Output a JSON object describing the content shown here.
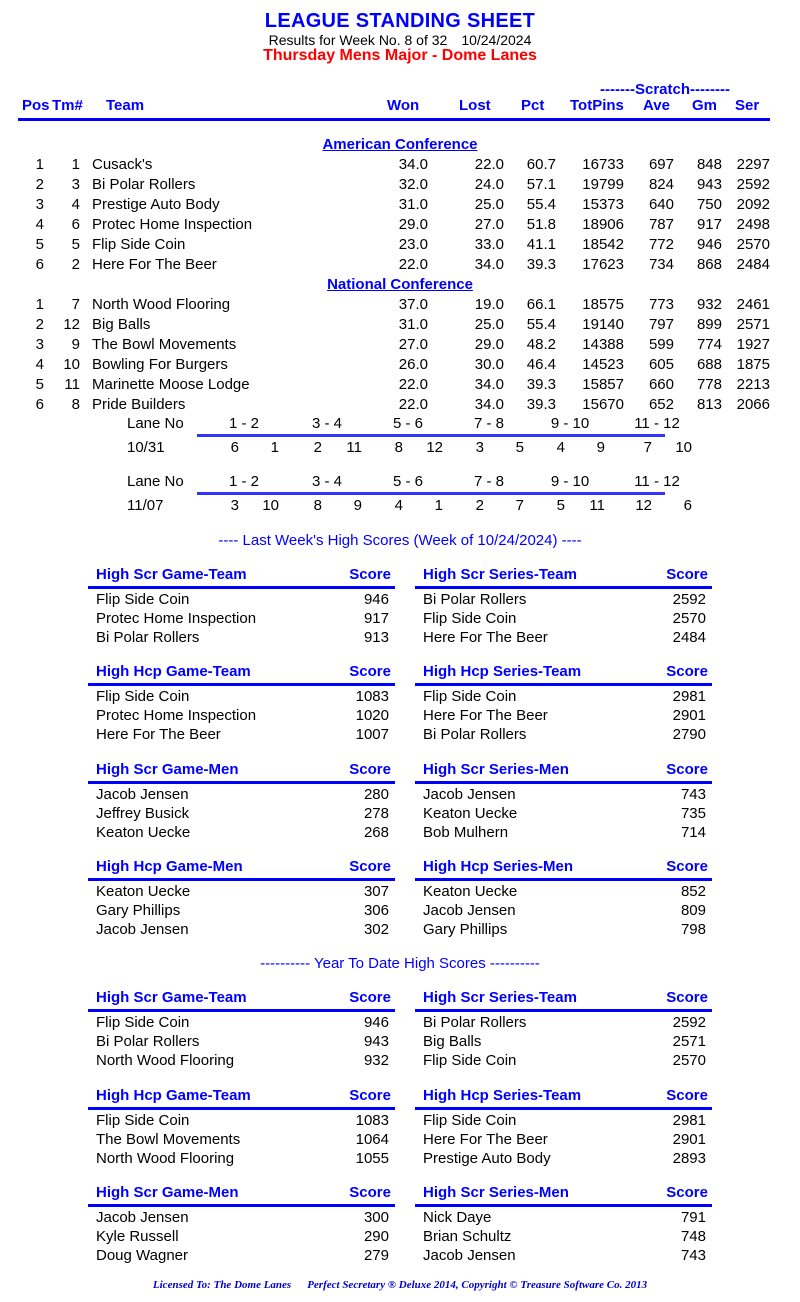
{
  "header": {
    "title": "LEAGUE STANDING SHEET",
    "results_line_left": "Results for Week No. 8 of 32",
    "results_line_date": "10/24/2024",
    "league_line": "Thursday Mens Major - Dome Lanes",
    "title_color": "#0000ff",
    "league_color": "#ff0000"
  },
  "standings": {
    "scratch_label": "-------Scratch--------",
    "columns": {
      "pos": "Pos",
      "tm": "Tm#",
      "team": "Team",
      "won": "Won",
      "lost": "Lost",
      "pct": "Pct",
      "totpins": "TotPins",
      "ave": "Ave",
      "gm": "Gm",
      "ser": "Ser"
    },
    "conferences": [
      {
        "name": "American Conference",
        "rows": [
          {
            "pos": "1",
            "tm": "1",
            "team": "Cusack's",
            "won": "34.0",
            "lost": "22.0",
            "pct": "60.7",
            "totpins": "16733",
            "ave": "697",
            "gm": "848",
            "ser": "2297"
          },
          {
            "pos": "2",
            "tm": "3",
            "team": "Bi Polar Rollers",
            "won": "32.0",
            "lost": "24.0",
            "pct": "57.1",
            "totpins": "19799",
            "ave": "824",
            "gm": "943",
            "ser": "2592"
          },
          {
            "pos": "3",
            "tm": "4",
            "team": "Prestige Auto Body",
            "won": "31.0",
            "lost": "25.0",
            "pct": "55.4",
            "totpins": "15373",
            "ave": "640",
            "gm": "750",
            "ser": "2092"
          },
          {
            "pos": "4",
            "tm": "6",
            "team": "Protec Home Inspection",
            "won": "29.0",
            "lost": "27.0",
            "pct": "51.8",
            "totpins": "18906",
            "ave": "787",
            "gm": "917",
            "ser": "2498"
          },
          {
            "pos": "5",
            "tm": "5",
            "team": "Flip Side Coin",
            "won": "23.0",
            "lost": "33.0",
            "pct": "41.1",
            "totpins": "18542",
            "ave": "772",
            "gm": "946",
            "ser": "2570"
          },
          {
            "pos": "6",
            "tm": "2",
            "team": "Here For The Beer",
            "won": "22.0",
            "lost": "34.0",
            "pct": "39.3",
            "totpins": "17623",
            "ave": "734",
            "gm": "868",
            "ser": "2484"
          }
        ]
      },
      {
        "name": "National Conference",
        "rows": [
          {
            "pos": "1",
            "tm": "7",
            "team": "North Wood Flooring",
            "won": "37.0",
            "lost": "19.0",
            "pct": "66.1",
            "totpins": "18575",
            "ave": "773",
            "gm": "932",
            "ser": "2461"
          },
          {
            "pos": "2",
            "tm": "12",
            "team": "Big Balls",
            "won": "31.0",
            "lost": "25.0",
            "pct": "55.4",
            "totpins": "19140",
            "ave": "797",
            "gm": "899",
            "ser": "2571"
          },
          {
            "pos": "3",
            "tm": "9",
            "team": "The Bowl Movements",
            "won": "27.0",
            "lost": "29.0",
            "pct": "48.2",
            "totpins": "14388",
            "ave": "599",
            "gm": "774",
            "ser": "1927"
          },
          {
            "pos": "4",
            "tm": "10",
            "team": "Bowling For Burgers",
            "won": "26.0",
            "lost": "30.0",
            "pct": "46.4",
            "totpins": "14523",
            "ave": "605",
            "gm": "688",
            "ser": "1875"
          },
          {
            "pos": "5",
            "tm": "11",
            "team": "Marinette Moose Lodge",
            "won": "22.0",
            "lost": "34.0",
            "pct": "39.3",
            "totpins": "15857",
            "ave": "660",
            "gm": "778",
            "ser": "2213"
          },
          {
            "pos": "6",
            "tm": "8",
            "team": "Pride Builders",
            "won": "22.0",
            "lost": "34.0",
            "pct": "39.3",
            "totpins": "15670",
            "ave": "652",
            "gm": "813",
            "ser": "2066"
          }
        ]
      }
    ]
  },
  "lane_schedule": {
    "lane_label": "Lane No",
    "lane_pairs": [
      "1 - 2",
      "3 - 4",
      "5 - 6",
      "7 - 8",
      "9 - 10",
      "11 - 12"
    ],
    "weeks": [
      {
        "date": "10/31",
        "matchups": [
          [
            "6",
            "1"
          ],
          [
            "2",
            "11"
          ],
          [
            "8",
            "12"
          ],
          [
            "3",
            "5"
          ],
          [
            "4",
            "9"
          ],
          [
            "7",
            "10"
          ]
        ]
      },
      {
        "date": "11/07",
        "matchups": [
          [
            "3",
            "10"
          ],
          [
            "8",
            "9"
          ],
          [
            "4",
            "1"
          ],
          [
            "2",
            "7"
          ],
          [
            "5",
            "11"
          ],
          [
            "12",
            "6"
          ]
        ]
      }
    ]
  },
  "last_week": {
    "banner": "----  Last Week's High Scores   (Week of 10/24/2024)  ----",
    "score_header": "Score",
    "groups": [
      {
        "left": {
          "title": "High Scr Game-Team",
          "rows": [
            {
              "name": "Flip Side Coin",
              "score": "946"
            },
            {
              "name": "Protec Home Inspection",
              "score": "917"
            },
            {
              "name": "Bi Polar Rollers",
              "score": "913"
            }
          ]
        },
        "right": {
          "title": "High Scr Series-Team",
          "rows": [
            {
              "name": "Bi Polar Rollers",
              "score": "2592"
            },
            {
              "name": "Flip Side Coin",
              "score": "2570"
            },
            {
              "name": "Here For The Beer",
              "score": "2484"
            }
          ]
        }
      },
      {
        "left": {
          "title": "High Hcp Game-Team",
          "rows": [
            {
              "name": "Flip Side Coin",
              "score": "1083"
            },
            {
              "name": "Protec Home Inspection",
              "score": "1020"
            },
            {
              "name": "Here For The Beer",
              "score": "1007"
            }
          ]
        },
        "right": {
          "title": "High Hcp Series-Team",
          "rows": [
            {
              "name": "Flip Side Coin",
              "score": "2981"
            },
            {
              "name": "Here For The Beer",
              "score": "2901"
            },
            {
              "name": "Bi Polar Rollers",
              "score": "2790"
            }
          ]
        }
      },
      {
        "left": {
          "title": "High Scr Game-Men",
          "rows": [
            {
              "name": "Jacob Jensen",
              "score": "280"
            },
            {
              "name": "Jeffrey Busick",
              "score": "278"
            },
            {
              "name": "Keaton Uecke",
              "score": "268"
            }
          ]
        },
        "right": {
          "title": "High Scr Series-Men",
          "rows": [
            {
              "name": "Jacob Jensen",
              "score": "743"
            },
            {
              "name": "Keaton Uecke",
              "score": "735"
            },
            {
              "name": "Bob Mulhern",
              "score": "714"
            }
          ]
        }
      },
      {
        "left": {
          "title": "High Hcp Game-Men",
          "rows": [
            {
              "name": "Keaton Uecke",
              "score": "307"
            },
            {
              "name": "Gary Phillips",
              "score": "306"
            },
            {
              "name": "Jacob Jensen",
              "score": "302"
            }
          ]
        },
        "right": {
          "title": "High Hcp Series-Men",
          "rows": [
            {
              "name": "Keaton Uecke",
              "score": "852"
            },
            {
              "name": "Jacob Jensen",
              "score": "809"
            },
            {
              "name": "Gary Phillips",
              "score": "798"
            }
          ]
        }
      }
    ]
  },
  "year_to_date": {
    "banner": "---------- Year To Date High Scores ----------",
    "score_header": "Score",
    "groups": [
      {
        "left": {
          "title": "High Scr Game-Team",
          "rows": [
            {
              "name": "Flip Side Coin",
              "score": "946"
            },
            {
              "name": "Bi Polar Rollers",
              "score": "943"
            },
            {
              "name": "North Wood Flooring",
              "score": "932"
            }
          ]
        },
        "right": {
          "title": "High Scr Series-Team",
          "rows": [
            {
              "name": "Bi Polar Rollers",
              "score": "2592"
            },
            {
              "name": "Big Balls",
              "score": "2571"
            },
            {
              "name": "Flip Side Coin",
              "score": "2570"
            }
          ]
        }
      },
      {
        "left": {
          "title": "High Hcp Game-Team",
          "rows": [
            {
              "name": "Flip Side Coin",
              "score": "1083"
            },
            {
              "name": "The Bowl Movements",
              "score": "1064"
            },
            {
              "name": "North Wood Flooring",
              "score": "1055"
            }
          ]
        },
        "right": {
          "title": "High Hcp Series-Team",
          "rows": [
            {
              "name": "Flip Side Coin",
              "score": "2981"
            },
            {
              "name": "Here For The Beer",
              "score": "2901"
            },
            {
              "name": "Prestige Auto Body",
              "score": "2893"
            }
          ]
        }
      },
      {
        "left": {
          "title": "High Scr Game-Men",
          "rows": [
            {
              "name": "Jacob Jensen",
              "score": "300"
            },
            {
              "name": "Kyle Russell",
              "score": "290"
            },
            {
              "name": "Doug Wagner",
              "score": "279"
            }
          ]
        },
        "right": {
          "title": "High Scr Series-Men",
          "rows": [
            {
              "name": "Nick Daye",
              "score": "791"
            },
            {
              "name": "Brian Schultz",
              "score": "748"
            },
            {
              "name": "Jacob Jensen",
              "score": "743"
            }
          ]
        }
      }
    ]
  },
  "footer": {
    "licensed_to": "Licensed To: The Dome Lanes",
    "copyright": "Perfect Secretary ® Deluxe  2014, Copyright © Treasure Software Co. 2013"
  }
}
